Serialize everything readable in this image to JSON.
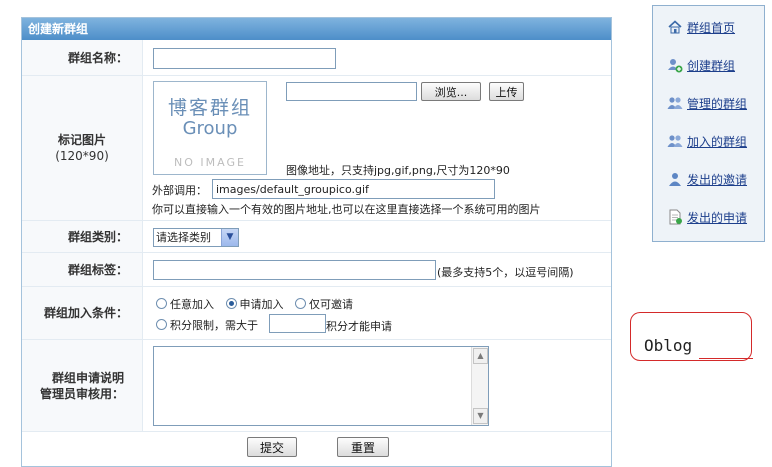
{
  "form": {
    "title": "创建新群组",
    "name": {
      "label": "群组名称：",
      "value": ""
    },
    "logo": {
      "label": "标记图片",
      "size_hint": "(120*90)",
      "placeholder_line1": "博客群组",
      "placeholder_line2": "Group",
      "placeholder_line3": "NO IMAGE",
      "file_value": "",
      "browse_label": "浏览...",
      "upload_label": "上传",
      "note": "图像地址，只支持jpg,gif,png,尺寸为120*90",
      "external_label": "外部调用：",
      "external_value": "images/default_groupico.gif",
      "help": "你可以直接输入一个有效的图片地址,也可以在这里直接选择一个系统可用的图片"
    },
    "category": {
      "label": "群组类别：",
      "selected": "请选择类别"
    },
    "tags": {
      "label": "群组标签：",
      "value": "",
      "hint": "(最多支持5个，以逗号间隔)"
    },
    "join": {
      "label": "群组加入条件：",
      "options": [
        {
          "label": "任意加入",
          "checked": false
        },
        {
          "label": "申请加入",
          "checked": true
        },
        {
          "label": "仅可邀请",
          "checked": false
        }
      ],
      "points_prefix": "积分限制，需大于",
      "points_value": "",
      "points_suffix": "积分才能申请"
    },
    "description": {
      "label_line1": "群组申请说明",
      "label_line2": "管理员审核用：",
      "value": ""
    },
    "submit_label": "提交",
    "reset_label": "重置"
  },
  "sidebar": {
    "items": [
      {
        "label": "群组首页",
        "icon": "home-icon"
      },
      {
        "label": "创建群组",
        "icon": "group-add-icon"
      },
      {
        "label": "管理的群组",
        "icon": "group-manage-icon"
      },
      {
        "label": "加入的群组",
        "icon": "group-joined-icon"
      },
      {
        "label": "发出的邀请",
        "icon": "user-invite-icon"
      },
      {
        "label": "发出的申请",
        "icon": "document-request-icon"
      }
    ]
  },
  "annotation": {
    "text": "Oblog"
  },
  "colors": {
    "header_start": "#7fb3de",
    "header_end": "#4d8ec9",
    "link": "#1d3f8c",
    "annotation": "#d42a2a"
  }
}
